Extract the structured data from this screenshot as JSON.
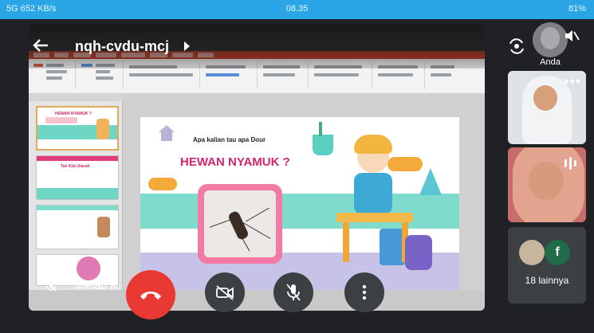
{
  "status_bar": {
    "network": "5G 652 KB/s",
    "time": "08.35",
    "battery": "81%"
  },
  "meeting": {
    "code": "nqh-cvdu-mcj"
  },
  "slide": {
    "subtitle": "Apa kalian tau apa Dour",
    "title": "HEWAN NYAMUK ?"
  },
  "thumbnails": [
    {
      "title": "HEWAN NYAMUK ?"
    },
    {
      "title": "Tak Kita Ulasah"
    },
    {
      "title": ""
    },
    {
      "title": ""
    }
  ],
  "self": {
    "name_overlay": "Melati K",
    "tile_label": "Anda"
  },
  "controls": {
    "end_call": "end-call",
    "camera": "camera-off",
    "mic": "mic-off",
    "more": "more-options"
  },
  "participants": {
    "others_avatar_letter": "f",
    "others_label": "18 lainnya"
  },
  "colors": {
    "status_bar": "#2aa6e6",
    "end_call": "#e83a33",
    "control_bg": "#3c4043",
    "slide_title": "#d6246e"
  }
}
